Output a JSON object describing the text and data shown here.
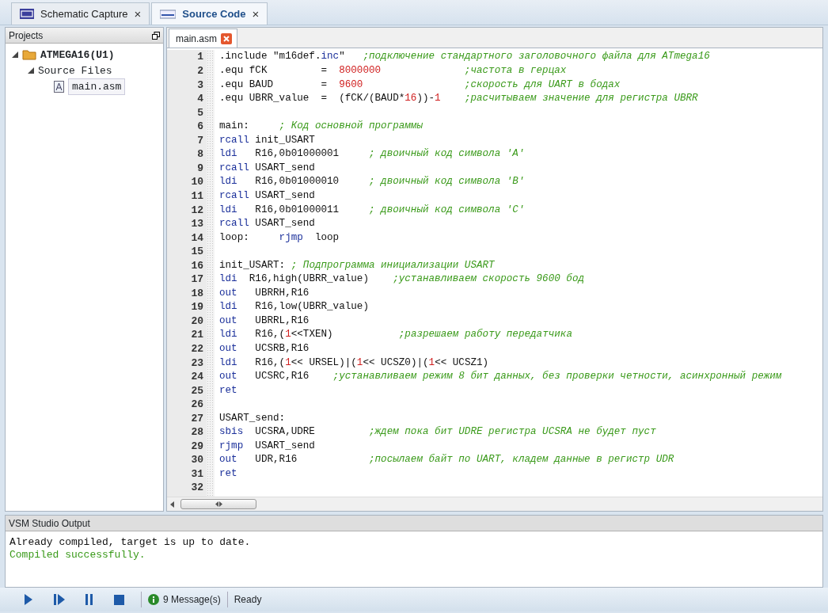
{
  "document_tabs": [
    {
      "label": "Schematic Capture",
      "close": "×",
      "selected": false
    },
    {
      "label": "Source Code",
      "close": "×",
      "selected": true
    }
  ],
  "projects": {
    "title": "Projects",
    "tree": [
      {
        "label": "ATMEGA16(U1)",
        "kind": "project",
        "expanded": true,
        "children": [
          {
            "label": "Source Files",
            "expanded": true,
            "children": [
              {
                "label": "main.asm",
                "kind": "file",
                "selected": true
              }
            ]
          }
        ]
      }
    ]
  },
  "editor": {
    "tab": {
      "label": "main.asm",
      "selected": true
    },
    "lines": [
      {
        "number": "1",
        "tokens": [
          {
            "kind": "plain",
            "text": ".include \"m16def."
          },
          {
            "kind": "keyword",
            "text": "inc"
          },
          {
            "kind": "plain",
            "text": "\"   "
          },
          {
            "kind": "comment",
            "text": ";подключение стандартного заголовочного файла для ATmega16"
          }
        ]
      },
      {
        "number": "2",
        "tokens": [
          {
            "kind": "plain",
            "text": ".equ fCK         =  "
          },
          {
            "kind": "number",
            "text": "8000000"
          },
          {
            "kind": "comment",
            "text": "              ;частота в герцах"
          }
        ]
      },
      {
        "number": "3",
        "tokens": [
          {
            "kind": "plain",
            "text": ".equ BAUD        =  "
          },
          {
            "kind": "number",
            "text": "9600"
          },
          {
            "kind": "comment",
            "text": "                 ;скорость для UART в бодах"
          }
        ]
      },
      {
        "number": "4",
        "tokens": [
          {
            "kind": "plain",
            "text": ".equ UBRR_value  =  (fCK/(BAUD*"
          },
          {
            "kind": "number",
            "text": "16"
          },
          {
            "kind": "plain",
            "text": "))-"
          },
          {
            "kind": "number",
            "text": "1"
          },
          {
            "kind": "comment",
            "text": "    ;расчитываем значение для регистра UBRR"
          }
        ]
      },
      {
        "number": "5"
      },
      {
        "number": "6",
        "tokens": [
          {
            "kind": "plain",
            "text": "main:     "
          },
          {
            "kind": "comment",
            "text": "; Код основной программы"
          }
        ]
      },
      {
        "number": "7",
        "tokens": [
          {
            "kind": "keyword",
            "text": "rcall"
          },
          {
            "kind": "plain",
            "text": " init_USART"
          }
        ]
      },
      {
        "number": "8",
        "tokens": [
          {
            "kind": "keyword",
            "text": "ldi"
          },
          {
            "kind": "plain",
            "text": "   R16,0b01000001     "
          },
          {
            "kind": "comment",
            "text": "; двоичный код символа 'A'"
          }
        ]
      },
      {
        "number": "9",
        "tokens": [
          {
            "kind": "keyword",
            "text": "rcall"
          },
          {
            "kind": "plain",
            "text": " USART_send"
          }
        ]
      },
      {
        "number": "10",
        "tokens": [
          {
            "kind": "keyword",
            "text": "ldi"
          },
          {
            "kind": "plain",
            "text": "   R16,0b01000010     "
          },
          {
            "kind": "comment",
            "text": "; двоичный код символа 'B'"
          }
        ]
      },
      {
        "number": "11",
        "tokens": [
          {
            "kind": "keyword",
            "text": "rcall"
          },
          {
            "kind": "plain",
            "text": " USART_send"
          }
        ]
      },
      {
        "number": "12",
        "tokens": [
          {
            "kind": "keyword",
            "text": "ldi"
          },
          {
            "kind": "plain",
            "text": "   R16,0b01000011     "
          },
          {
            "kind": "comment",
            "text": "; двоичный код символа 'C'"
          }
        ]
      },
      {
        "number": "13",
        "tokens": [
          {
            "kind": "keyword",
            "text": "rcall"
          },
          {
            "kind": "plain",
            "text": " USART_send"
          }
        ]
      },
      {
        "number": "14",
        "tokens": [
          {
            "kind": "plain",
            "text": "loop:     "
          },
          {
            "kind": "keyword",
            "text": "rjmp"
          },
          {
            "kind": "plain",
            "text": "  loop"
          }
        ]
      },
      {
        "number": "15"
      },
      {
        "number": "16",
        "tokens": [
          {
            "kind": "plain",
            "text": "init_USART: "
          },
          {
            "kind": "comment",
            "text": "; Подпрограмма инициализации USART"
          }
        ]
      },
      {
        "number": "17",
        "tokens": [
          {
            "kind": "keyword",
            "text": "ldi"
          },
          {
            "kind": "plain",
            "text": "  R16,high(UBRR_value)    "
          },
          {
            "kind": "comment",
            "text": ";устанавливаем скорость 9600 бод"
          }
        ]
      },
      {
        "number": "18",
        "tokens": [
          {
            "kind": "keyword",
            "text": "out"
          },
          {
            "kind": "plain",
            "text": "   UBRRH,R16"
          }
        ]
      },
      {
        "number": "19",
        "tokens": [
          {
            "kind": "keyword",
            "text": "ldi"
          },
          {
            "kind": "plain",
            "text": "   R16,low(UBRR_value)"
          }
        ]
      },
      {
        "number": "20",
        "tokens": [
          {
            "kind": "keyword",
            "text": "out"
          },
          {
            "kind": "plain",
            "text": "   UBRRL,R16"
          }
        ]
      },
      {
        "number": "21",
        "tokens": [
          {
            "kind": "keyword",
            "text": "ldi"
          },
          {
            "kind": "plain",
            "text": "   R16,("
          },
          {
            "kind": "number",
            "text": "1"
          },
          {
            "kind": "plain",
            "text": "<<TXEN)           "
          },
          {
            "kind": "comment",
            "text": ";разрешаем работу передатчика"
          }
        ]
      },
      {
        "number": "22",
        "tokens": [
          {
            "kind": "keyword",
            "text": "out"
          },
          {
            "kind": "plain",
            "text": "   UCSRB,R16"
          }
        ]
      },
      {
        "number": "23",
        "tokens": [
          {
            "kind": "keyword",
            "text": "ldi"
          },
          {
            "kind": "plain",
            "text": "   R16,("
          },
          {
            "kind": "number",
            "text": "1"
          },
          {
            "kind": "plain",
            "text": "<< URSEL)|("
          },
          {
            "kind": "number",
            "text": "1"
          },
          {
            "kind": "plain",
            "text": "<< UCSZ0)|("
          },
          {
            "kind": "number",
            "text": "1"
          },
          {
            "kind": "plain",
            "text": "<< UCSZ1)"
          }
        ]
      },
      {
        "number": "24",
        "tokens": [
          {
            "kind": "keyword",
            "text": "out"
          },
          {
            "kind": "plain",
            "text": "   UCSRC,R16    "
          },
          {
            "kind": "comment",
            "text": ";устанавливаем режим 8 бит данных, без проверки четности, асинхронный режим"
          }
        ]
      },
      {
        "number": "25",
        "tokens": [
          {
            "kind": "keyword",
            "text": "ret"
          }
        ]
      },
      {
        "number": "26"
      },
      {
        "number": "27",
        "tokens": [
          {
            "kind": "plain",
            "text": "USART_send:"
          }
        ]
      },
      {
        "number": "28",
        "tokens": [
          {
            "kind": "keyword",
            "text": "sbis"
          },
          {
            "kind": "plain",
            "text": "  UCSRA,UDRE         "
          },
          {
            "kind": "comment",
            "text": ";ждем пока бит UDRE регистра UCSRA не будет пуст"
          }
        ]
      },
      {
        "number": "29",
        "tokens": [
          {
            "kind": "keyword",
            "text": "rjmp"
          },
          {
            "kind": "plain",
            "text": "  USART_send"
          }
        ]
      },
      {
        "number": "30",
        "tokens": [
          {
            "kind": "keyword",
            "text": "out"
          },
          {
            "kind": "plain",
            "text": "   UDR,R16            "
          },
          {
            "kind": "comment",
            "text": ";посылаем байт по UART, кладем данные в регистр UDR"
          }
        ]
      },
      {
        "number": "31",
        "tokens": [
          {
            "kind": "keyword",
            "text": "ret"
          }
        ]
      },
      {
        "number": "32"
      }
    ]
  },
  "output": {
    "title": "VSM Studio Output",
    "lines": [
      {
        "text": "Already compiled, target is up to date.",
        "kind": "info"
      },
      {
        "text": "Compiled successfully.",
        "kind": "success"
      }
    ]
  },
  "toolbar": {
    "buttons": [
      {
        "kind": "play"
      },
      {
        "kind": "step"
      },
      {
        "kind": "pause"
      },
      {
        "kind": "stop"
      }
    ],
    "messages": "9 Message(s)",
    "status": "Ready"
  }
}
